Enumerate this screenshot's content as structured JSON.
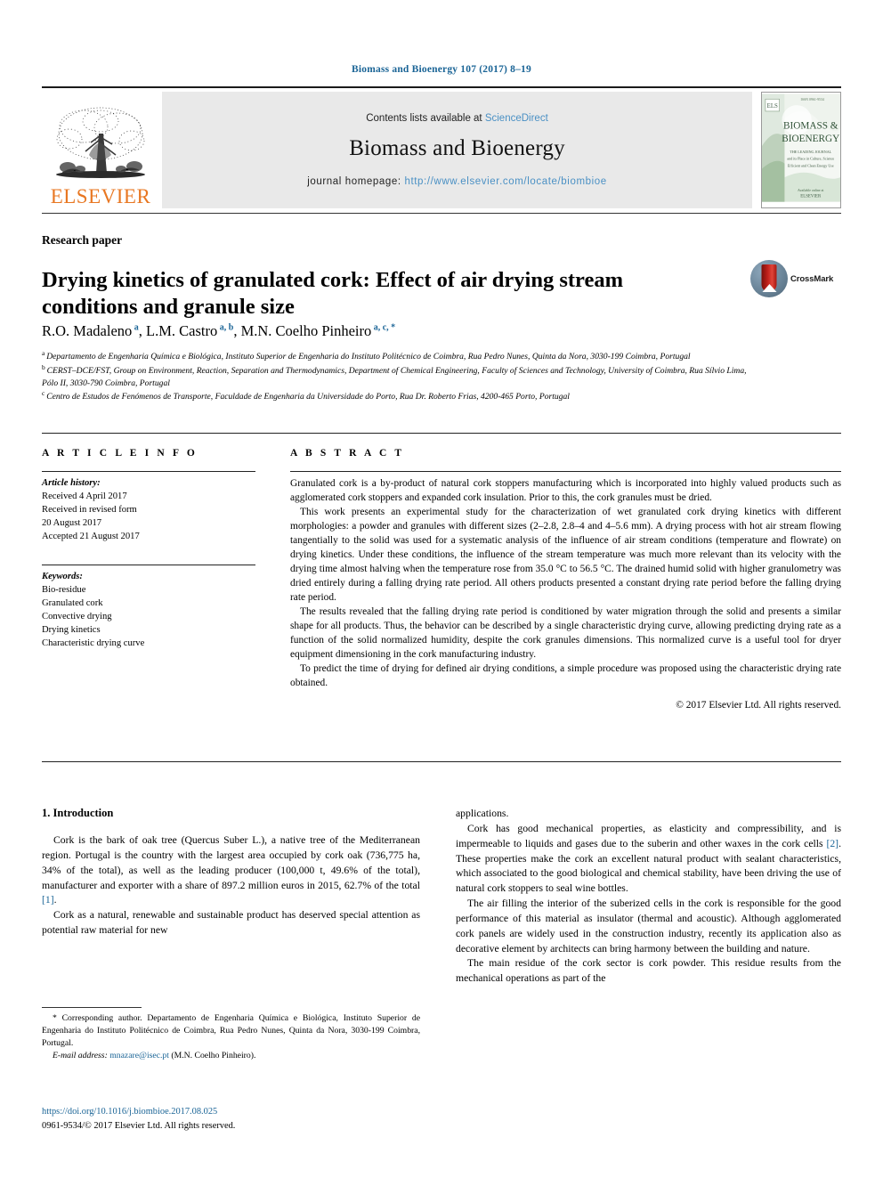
{
  "running_head": "Biomass and Bioenergy 107 (2017) 8–19",
  "masthead": {
    "publisher_name": "ELSEVIER",
    "contents_prefix": "Contents lists available at ",
    "contents_link": "ScienceDirect",
    "journal_title": "Biomass and Bioenergy",
    "homepage_prefix": "journal homepage: ",
    "homepage_url": "http://www.elsevier.com/locate/biombioe",
    "cover": {
      "line1": "BIOMASS &",
      "line2": "BIOENERGY",
      "sub1": "THE LEADING JOURNAL",
      "sub2": "and its Place in Culture, Science",
      "sub3": "Efficient and Clean Energy Use",
      "publisher": "ELSEVIER"
    }
  },
  "article": {
    "type_label": "Research paper",
    "title": "Drying kinetics of granulated cork: Effect of air drying stream conditions and granule size",
    "crossmark_label": "CrossMark",
    "authors": [
      {
        "name": "R.O. Madaleno",
        "sup": "a"
      },
      {
        "name": "L.M. Castro",
        "sup": "a, b"
      },
      {
        "name": "M.N. Coelho Pinheiro",
        "sup": "a, c, *"
      }
    ],
    "affiliations": [
      {
        "marker": "a",
        "text": "Departamento de Engenharia Química e Biológica, Instituto Superior de Engenharia do Instituto Politécnico de Coimbra, Rua Pedro Nunes, Quinta da Nora, 3030-199 Coimbra, Portugal"
      },
      {
        "marker": "b",
        "text": "CERST–DCE/FST, Group on Environment, Reaction, Separation and Thermodynamics, Department of Chemical Engineering, Faculty of Sciences and Technology, University of Coimbra, Rua Sílvio Lima, Pólo II, 3030-790 Coimbra, Portugal"
      },
      {
        "marker": "c",
        "text": "Centro de Estudos de Fenómenos de Transporte, Faculdade de Engenharia da Universidade do Porto, Rua Dr. Roberto Frias, 4200-465 Porto, Portugal"
      }
    ]
  },
  "article_info": {
    "heading": "A R T I C L E   I N F O",
    "history_label": "Article history:",
    "history": [
      "Received 4 April 2017",
      "Received in revised form",
      "20 August 2017",
      "Accepted 21 August 2017"
    ],
    "keywords_label": "Keywords:",
    "keywords": [
      "Bio-residue",
      "Granulated cork",
      "Convective drying",
      "Drying kinetics",
      "Characteristic drying curve"
    ]
  },
  "abstract": {
    "heading": "A B S T R A C T",
    "paragraphs": [
      "Granulated cork is a by-product of natural cork stoppers manufacturing which is incorporated into highly valued products such as agglomerated cork stoppers and expanded cork insulation. Prior to this, the cork granules must be dried.",
      "This work presents an experimental study for the characterization of wet granulated cork drying kinetics with different morphologies: a powder and granules with different sizes (2–2.8, 2.8–4 and 4–5.6 mm). A drying process with hot air stream flowing tangentially to the solid was used for a systematic analysis of the influence of air stream conditions (temperature and flowrate) on drying kinetics. Under these conditions, the influence of the stream temperature was much more relevant than its velocity with the drying time almost halving when the temperature rose from 35.0 °C to 56.5 °C. The drained humid solid with higher granulometry was dried entirely during a falling drying rate period. All others products presented a constant drying rate period before the falling drying rate period.",
      "The results revealed that the falling drying rate period is conditioned by water migration through the solid and presents a similar shape for all products. Thus, the behavior can be described by a single characteristic drying curve, allowing predicting drying rate as a function of the solid normalized humidity, despite the cork granules dimensions. This normalized curve is a useful tool for dryer equipment dimensioning in the cork manufacturing industry.",
      "To predict the time of drying for defined air drying conditions, a simple procedure was proposed using the characteristic drying rate obtained."
    ],
    "copyright": "© 2017 Elsevier Ltd. All rights reserved."
  },
  "body": {
    "section_heading": "1.  Introduction",
    "left_column": [
      "Cork is the bark of oak tree (Quercus Suber L.), a native tree of the Mediterranean region. Portugal is the country with the largest area occupied by cork oak (736,775 ha, 34% of the total), as well as the leading producer (100,000 t, 49.6% of the total), manufacturer and exporter with a share of 897.2 million euros in 2015, 62.7% of the total [1].",
      "Cork as a natural, renewable and sustainable product has deserved special attention as potential raw material for new"
    ],
    "right_column": [
      "applications.",
      "Cork has good mechanical properties, as elasticity and compressibility, and is impermeable to liquids and gases due to the suberin and other waxes in the cork cells [2]. These properties make the cork an excellent natural product with sealant characteristics, which associated to the good biological and chemical stability, have been driving the use of natural cork stoppers to seal wine bottles.",
      "The air filling the interior of the suberized cells in the cork is responsible for the good performance of this material as insulator (thermal and acoustic). Although agglomerated cork panels are widely used in the construction industry, recently its application also as decorative element by architects can bring harmony between the building and nature.",
      "The main residue of the cork sector is cork powder. This residue results from the mechanical operations as part of the"
    ]
  },
  "footnote": {
    "corresponding": "* Corresponding author. Departamento de Engenharia Química e Biológica, Instituto Superior de Engenharia do Instituto Politécnico de Coimbra, Rua Pedro Nunes, Quinta da Nora, 3030-199 Coimbra, Portugal.",
    "email_label": "E-mail address:",
    "email": "mnazare@isec.pt",
    "email_owner": "(M.N. Coelho Pinheiro).",
    "doi": "https://doi.org/10.1016/j.biombioe.2017.08.025",
    "issn_line": "0961-9534/© 2017 Elsevier Ltd. All rights reserved."
  },
  "colors": {
    "link_blue": "#1a6496",
    "sd_blue": "#4a90c4",
    "elsevier_orange": "#e87722",
    "masthead_grey": "#e9e9e9"
  }
}
